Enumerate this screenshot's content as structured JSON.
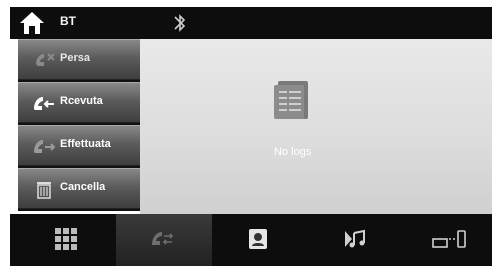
{
  "header": {
    "title": "BT"
  },
  "sidebar": {
    "items": [
      {
        "label": "Persa",
        "icon": "missed-call-icon"
      },
      {
        "label": "Rcevuta",
        "icon": "received-call-icon"
      },
      {
        "label": "Effettuata",
        "icon": "dialed-call-icon"
      },
      {
        "label": "Cancella",
        "icon": "trash-icon"
      }
    ]
  },
  "main": {
    "empty_message": "No logs"
  },
  "bottom_nav": {
    "tabs": [
      {
        "icon": "dialpad-icon"
      },
      {
        "icon": "call-log-icon",
        "active": true
      },
      {
        "icon": "contacts-icon"
      },
      {
        "icon": "music-icon"
      },
      {
        "icon": "devices-icon"
      }
    ]
  }
}
